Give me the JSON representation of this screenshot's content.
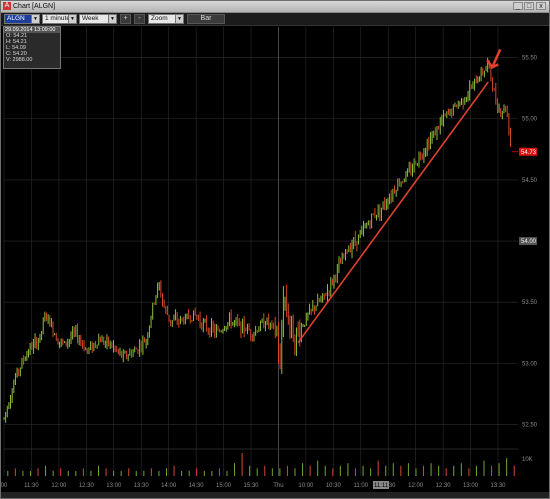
{
  "window": {
    "title": "Chart [ALGN]",
    "app_icon": "A",
    "controls": [
      "_",
      "□",
      "x"
    ]
  },
  "toolbar": {
    "symbol": "ALGN",
    "interval": "1 minute",
    "range": "Week",
    "plus": "+",
    "minus": "-",
    "zoom": "Zoom",
    "bar": "Bar"
  },
  "ohlc_panel": {
    "header": "29.09.2014 13:09:00",
    "lines": [
      "O: 54.21",
      "H: 54.21",
      "L: 54.09",
      "C: 54.20",
      "V: 2988.00"
    ]
  },
  "colors": {
    "up": "#8fbf3a",
    "down": "#d24a2a",
    "trendline": "#e0402e",
    "grid": "#2c2c2c",
    "volume": "#6fa832",
    "price_box": "#e01010"
  },
  "chart_data": {
    "type": "candlestick",
    "symbol": "ALGN",
    "interval": "1 minute",
    "xlabel": "",
    "ylabel": "",
    "y_ticks": [
      "52.50",
      "53.00",
      "53.50",
      "54.00",
      "54.50",
      "55.00",
      "55.50"
    ],
    "ylim": [
      52.3,
      55.75
    ],
    "x_ticks": [
      "00",
      "11:30",
      "12:00",
      "12:30",
      "13:00",
      "13:30",
      "14:00",
      "14:30",
      "15:00",
      "15:30",
      "Thu",
      "10:00",
      "10:30",
      "11:00",
      "11:30",
      "12:00",
      "12:30",
      "13:00",
      "13:30"
    ],
    "highlighted_tick": "11:11",
    "last_price_label": "54.73",
    "level_label": "54.00",
    "volume_label": "10K",
    "session_break_tick": "Thu",
    "price_path": [
      [
        0,
        52.55
      ],
      [
        4,
        52.9
      ],
      [
        8,
        53.1
      ],
      [
        12,
        53.2
      ],
      [
        14,
        53.4
      ],
      [
        16,
        53.3
      ],
      [
        18,
        53.2
      ],
      [
        20,
        53.15
      ],
      [
        24,
        53.25
      ],
      [
        28,
        53.1
      ],
      [
        32,
        53.2
      ],
      [
        36,
        53.15
      ],
      [
        40,
        53.05
      ],
      [
        44,
        53.1
      ],
      [
        48,
        53.2
      ],
      [
        50,
        53.45
      ],
      [
        52,
        53.65
      ],
      [
        54,
        53.45
      ],
      [
        56,
        53.35
      ],
      [
        60,
        53.35
      ],
      [
        64,
        53.4
      ],
      [
        68,
        53.3
      ],
      [
        72,
        53.25
      ],
      [
        76,
        53.35
      ],
      [
        80,
        53.3
      ],
      [
        84,
        53.25
      ],
      [
        88,
        53.35
      ],
      [
        92,
        53.25
      ],
      [
        93,
        52.9
      ],
      [
        94,
        53.6
      ],
      [
        96,
        53.35
      ],
      [
        98,
        53.2
      ],
      [
        100,
        53.3
      ],
      [
        104,
        53.45
      ],
      [
        108,
        53.55
      ],
      [
        112,
        53.75
      ],
      [
        116,
        53.95
      ],
      [
        120,
        54.05
      ],
      [
        124,
        54.2
      ],
      [
        128,
        54.3
      ],
      [
        132,
        54.45
      ],
      [
        136,
        54.55
      ],
      [
        140,
        54.7
      ],
      [
        144,
        54.85
      ],
      [
        148,
        55.0
      ],
      [
        152,
        55.1
      ],
      [
        156,
        55.2
      ],
      [
        160,
        55.35
      ],
      [
        163,
        55.45
      ],
      [
        165,
        55.2
      ],
      [
        167,
        55.05
      ],
      [
        169,
        55.1
      ],
      [
        171,
        54.73
      ]
    ],
    "trendline": [
      [
        99,
        53.17
      ],
      [
        163,
        55.3
      ]
    ],
    "arrow_at": [
      163,
      55.42
    ],
    "volume": [
      2,
      3,
      2,
      2,
      3,
      4,
      2,
      3,
      2,
      2,
      3,
      2,
      4,
      3,
      2,
      2,
      3,
      2,
      2,
      3,
      2,
      3,
      4,
      2,
      2,
      3,
      2,
      2,
      3,
      2,
      5,
      9,
      4,
      3,
      4,
      3,
      3,
      4,
      3,
      5,
      4,
      6,
      4,
      3,
      4,
      5,
      3,
      4,
      3,
      6,
      4,
      5,
      4,
      5,
      3,
      4,
      5,
      4,
      3,
      4,
      5,
      3,
      4,
      6,
      4,
      5,
      7,
      4
    ]
  }
}
